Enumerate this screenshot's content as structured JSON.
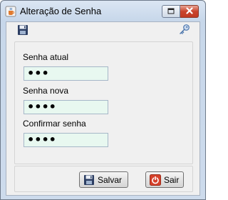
{
  "window": {
    "title": "Alteração de Senha",
    "icons": {
      "app": "java-cup-icon",
      "restore": "restore-icon",
      "close": "close-icon"
    }
  },
  "toolbar": {
    "save_icon": "floppy-disk-icon",
    "key_icon": "key-icon"
  },
  "form": {
    "current_password": {
      "label": "Senha atual",
      "value": "•••"
    },
    "new_password": {
      "label": "Senha nova",
      "value": "••••"
    },
    "confirm_password": {
      "label": "Confirmar senha",
      "value": "••••"
    }
  },
  "buttons": {
    "save_label": "Salvar",
    "exit_label": "Sair"
  },
  "colors": {
    "input_background": "#e8f8f0",
    "close_button": "#c9432b",
    "exit_icon": "#d6412b"
  }
}
